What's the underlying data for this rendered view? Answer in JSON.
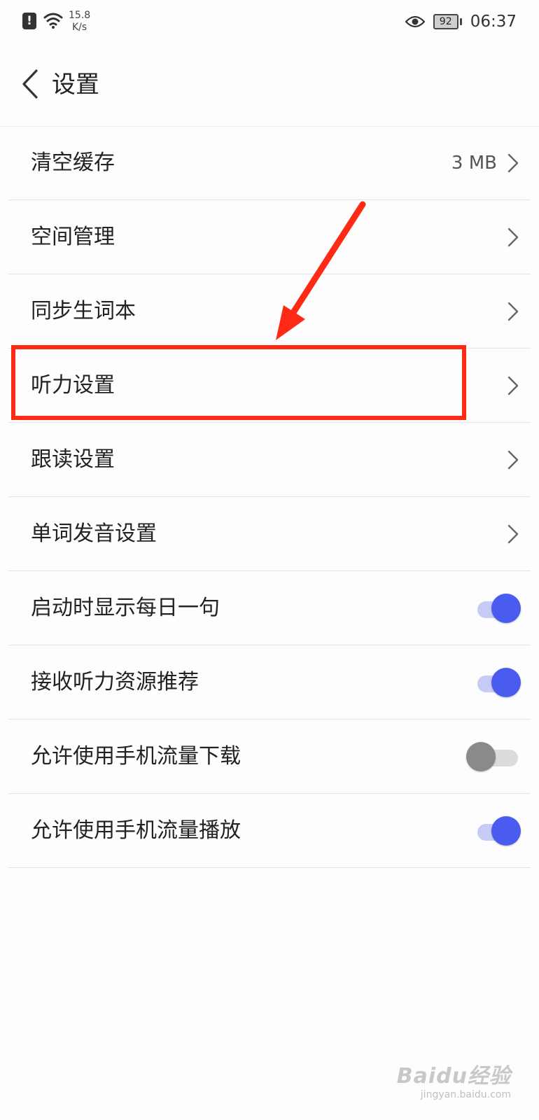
{
  "status_bar": {
    "net_speed_value": "15.8",
    "net_speed_unit": "K/s",
    "battery_level": "92",
    "time": "06:37",
    "alert_glyph": "!"
  },
  "header": {
    "title": "设置"
  },
  "settings": {
    "items": [
      {
        "label": "清空缓存",
        "value": "3 MB",
        "control": "chevron"
      },
      {
        "label": "空间管理",
        "control": "chevron"
      },
      {
        "label": "同步生词本",
        "control": "chevron"
      },
      {
        "label": "听力设置",
        "control": "chevron",
        "highlighted": true
      },
      {
        "label": "跟读设置",
        "control": "chevron"
      },
      {
        "label": "单词发音设置",
        "control": "chevron"
      },
      {
        "label": "启动时显示每日一句",
        "control": "toggle",
        "on": true
      },
      {
        "label": "接收听力资源推荐",
        "control": "toggle",
        "on": true
      },
      {
        "label": "允许使用手机流量下载",
        "control": "toggle",
        "on": false
      },
      {
        "label": "允许使用手机流量播放",
        "control": "toggle",
        "on": true
      }
    ]
  },
  "watermark": {
    "main": "Baidu经验",
    "sub": "jingyan.baidu.com"
  },
  "colors": {
    "annotation_red": "#ff2a15",
    "toggle_on": "#4a5bf0",
    "toggle_off": "#8a8a8a"
  },
  "icons": {
    "back": "chevron-left-icon",
    "row_arrow": "chevron-right-icon",
    "status": [
      "alert-icon",
      "wifi-icon",
      "eye-icon",
      "battery-icon"
    ]
  }
}
